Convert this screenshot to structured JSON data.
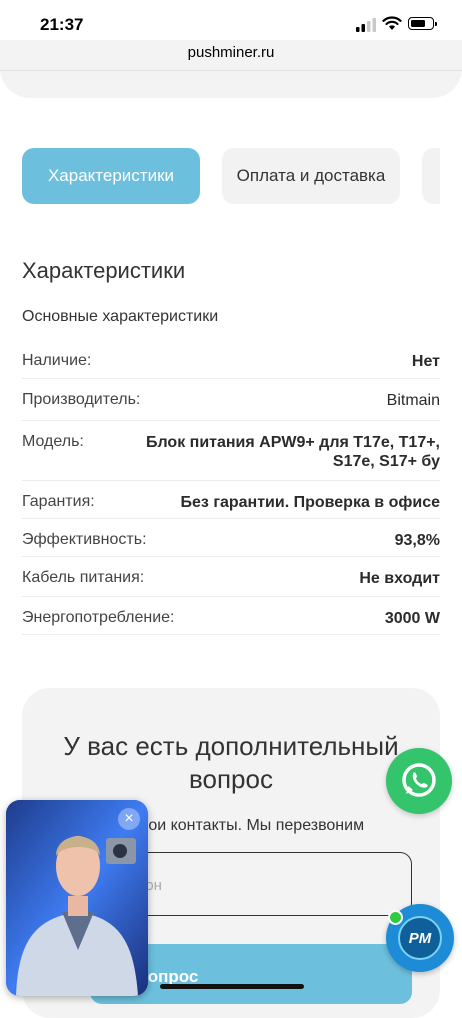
{
  "status_bar": {
    "time": "21:37"
  },
  "browser": {
    "url": "pushminer.ru"
  },
  "tabs": [
    {
      "label": "Характеристики",
      "active": true
    },
    {
      "label": "Оплата и доставка",
      "active": false
    },
    {
      "label": "",
      "active": false
    }
  ],
  "specs": {
    "title": "Характеристики",
    "subtitle": "Основные характеристики",
    "rows": [
      {
        "key": "Наличие:",
        "value": "Нет"
      },
      {
        "key": "Производитель:",
        "value": "Bitmain"
      },
      {
        "key": "Модель:",
        "value": "Блок питания APW9+ для T17e, T17+, S17e, S17+ бу"
      },
      {
        "key": "Гарантия:",
        "value": "Без гарантии. Проверка в офисе"
      },
      {
        "key": "Эффективность:",
        "value": "93,8%"
      },
      {
        "key": "Кабель питания:",
        "value": "Не входит"
      },
      {
        "key": "Энергопотребление:",
        "value": "3000 W"
      }
    ]
  },
  "contact_form": {
    "heading": "У вас есть дополнительный вопрос",
    "hint": "вои контакты. Мы перезвоним",
    "phone_placeholder": "рон",
    "submit_label": "ть вопрос"
  },
  "widgets": {
    "pm_badge": "PM",
    "video_close": "×"
  },
  "colors": {
    "accent": "#6cc0de",
    "whatsapp": "#34c46b",
    "pm": "#1e8bd6"
  }
}
